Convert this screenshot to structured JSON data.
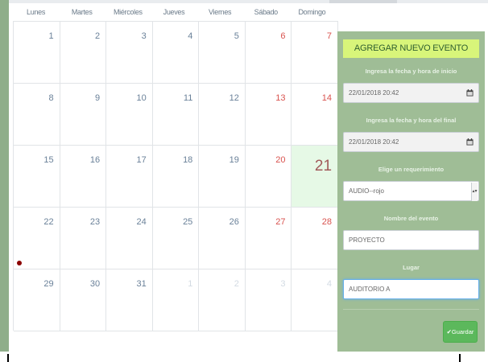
{
  "calendar": {
    "weekdays": [
      "Lunes",
      "Martes",
      "Miércoles",
      "Jueves",
      "Viernes",
      "Sábado",
      "Domingo"
    ],
    "weeks": [
      [
        "1",
        "2",
        "3",
        "4",
        "5",
        "6",
        "7"
      ],
      [
        "8",
        "9",
        "10",
        "11",
        "12",
        "13",
        "14"
      ],
      [
        "15",
        "16",
        "17",
        "18",
        "19",
        "20",
        "21"
      ],
      [
        "22",
        "23",
        "24",
        "25",
        "26",
        "27",
        "28"
      ],
      [
        "29",
        "30",
        "31",
        "1",
        "2",
        "3",
        "4"
      ]
    ],
    "today": "21",
    "event_color": "#8b0000"
  },
  "form": {
    "title": "AGREGAR NUEVO EVENTO",
    "start_label": "Ingresa la fecha y hora de inicio",
    "start_value": "22/01/2018 20:42",
    "end_label": "Ingresa la fecha y hora del final",
    "end_value": "22/01/2018 20:42",
    "requirement_label": "Elige un requerimiento",
    "requirement_value": "AUDIO--rojo",
    "event_name_label": "Nombre del evento",
    "event_name_value": "PROYECTO",
    "place_label": "Lugar",
    "place_value": "AUDITORIO A",
    "save_label": "✔Guardar",
    "icons": {
      "start": "calendar-icon",
      "end": "calendar-icon",
      "select": "chevron-updown-icon"
    }
  },
  "colors": {
    "panel": "#9fbd96",
    "title_bg": "#d8f57a",
    "today_bg": "#e6f9e6",
    "save": "#5cb85c"
  }
}
